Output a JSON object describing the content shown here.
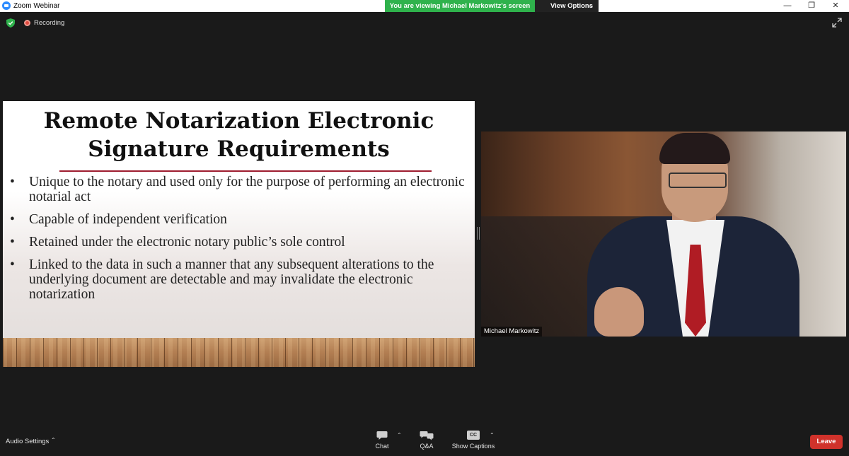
{
  "window": {
    "title": "Zoom Webinar",
    "controls": [
      "minimize",
      "restore",
      "close"
    ]
  },
  "banner": {
    "viewing_text": "You are viewing Michael Markowitz's screen",
    "view_options_label": "View Options"
  },
  "status": {
    "recording_label": "Recording"
  },
  "slide": {
    "title_line1": "Remote Notarization Electronic",
    "title_line2": "Signature Requirements",
    "bullets": [
      "Unique to the notary and used only for the purpose of performing an electronic notarial act",
      "Capable of independent verification",
      "Retained under the electronic notary public’s sole control",
      "Linked to the data in such a manner that any subsequent alterations to the underlying document are detectable and may invalidate the electronic notarization"
    ],
    "accent_color": "#9e1c2f"
  },
  "video": {
    "participant_name": "Michael Markowitz"
  },
  "toolbar": {
    "audio_settings_label": "Audio Settings",
    "chat_label": "Chat",
    "qa_label": "Q&A",
    "captions_label": "Show Captions",
    "captions_badge": "CC",
    "leave_label": "Leave"
  },
  "colors": {
    "banner_green": "#2fb24c",
    "leave_red": "#d0322b",
    "background": "#1a1a1a"
  }
}
